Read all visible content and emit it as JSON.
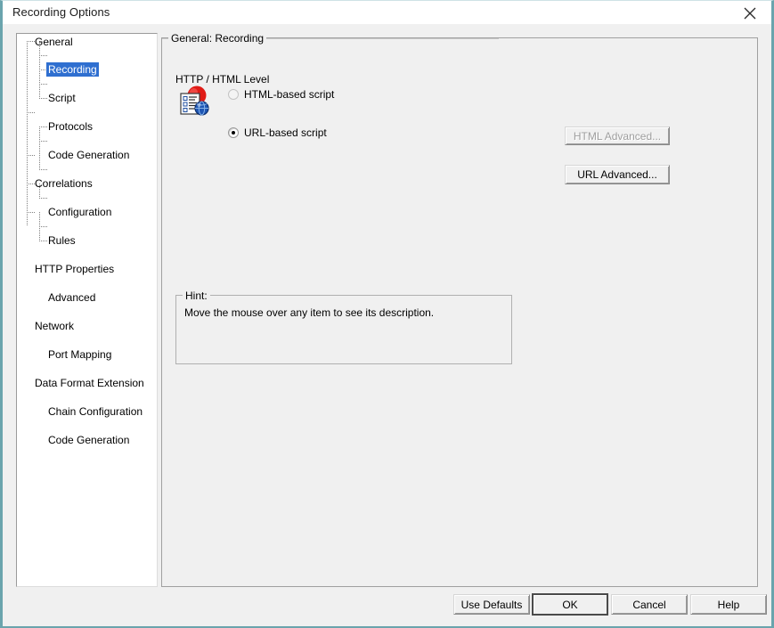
{
  "window": {
    "title": "Recording Options",
    "close_icon": "close-icon",
    "border_color": "#6aa4ad"
  },
  "sidebar": {
    "items": [
      {
        "label": "General",
        "level": 0,
        "selected": false
      },
      {
        "label": "Recording",
        "level": 1,
        "selected": true
      },
      {
        "label": "Script",
        "level": 1,
        "selected": false
      },
      {
        "label": "Protocols",
        "level": 1,
        "selected": false
      },
      {
        "label": "Code Generation",
        "level": 1,
        "selected": false
      },
      {
        "label": "Correlations",
        "level": 0,
        "selected": false
      },
      {
        "label": "Configuration",
        "level": 1,
        "selected": false
      },
      {
        "label": "Rules",
        "level": 1,
        "selected": false
      },
      {
        "label": "HTTP Properties",
        "level": 0,
        "selected": false
      },
      {
        "label": "Advanced",
        "level": 1,
        "selected": false
      },
      {
        "label": "Network",
        "level": 0,
        "selected": false
      },
      {
        "label": "Port Mapping",
        "level": 1,
        "selected": false
      },
      {
        "label": "Data Format Extension",
        "level": 0,
        "selected": false
      },
      {
        "label": "Chain Configuration",
        "level": 1,
        "selected": false
      },
      {
        "label": "Code Generation",
        "level": 1,
        "selected": false
      }
    ],
    "selection_color": "#2f6fd0"
  },
  "main": {
    "group_title": "General: Recording",
    "http_section": {
      "title": "HTTP / HTML Level",
      "icon": "recording-options-icon",
      "options": [
        {
          "label": "HTML-based script",
          "selected": false,
          "enabled": true
        },
        {
          "label": "URL-based script",
          "selected": true,
          "enabled": true
        }
      ],
      "buttons": [
        {
          "label": "HTML Advanced...",
          "enabled": false
        },
        {
          "label": "URL Advanced...",
          "enabled": true
        }
      ]
    },
    "hint": {
      "title": "Hint:",
      "text": "Move the mouse over any item to see its description."
    }
  },
  "footer": {
    "buttons": [
      {
        "label": "Use Defaults",
        "default": false
      },
      {
        "label": "OK",
        "default": true
      },
      {
        "label": "Cancel",
        "default": false
      },
      {
        "label": "Help",
        "default": false
      }
    ]
  }
}
